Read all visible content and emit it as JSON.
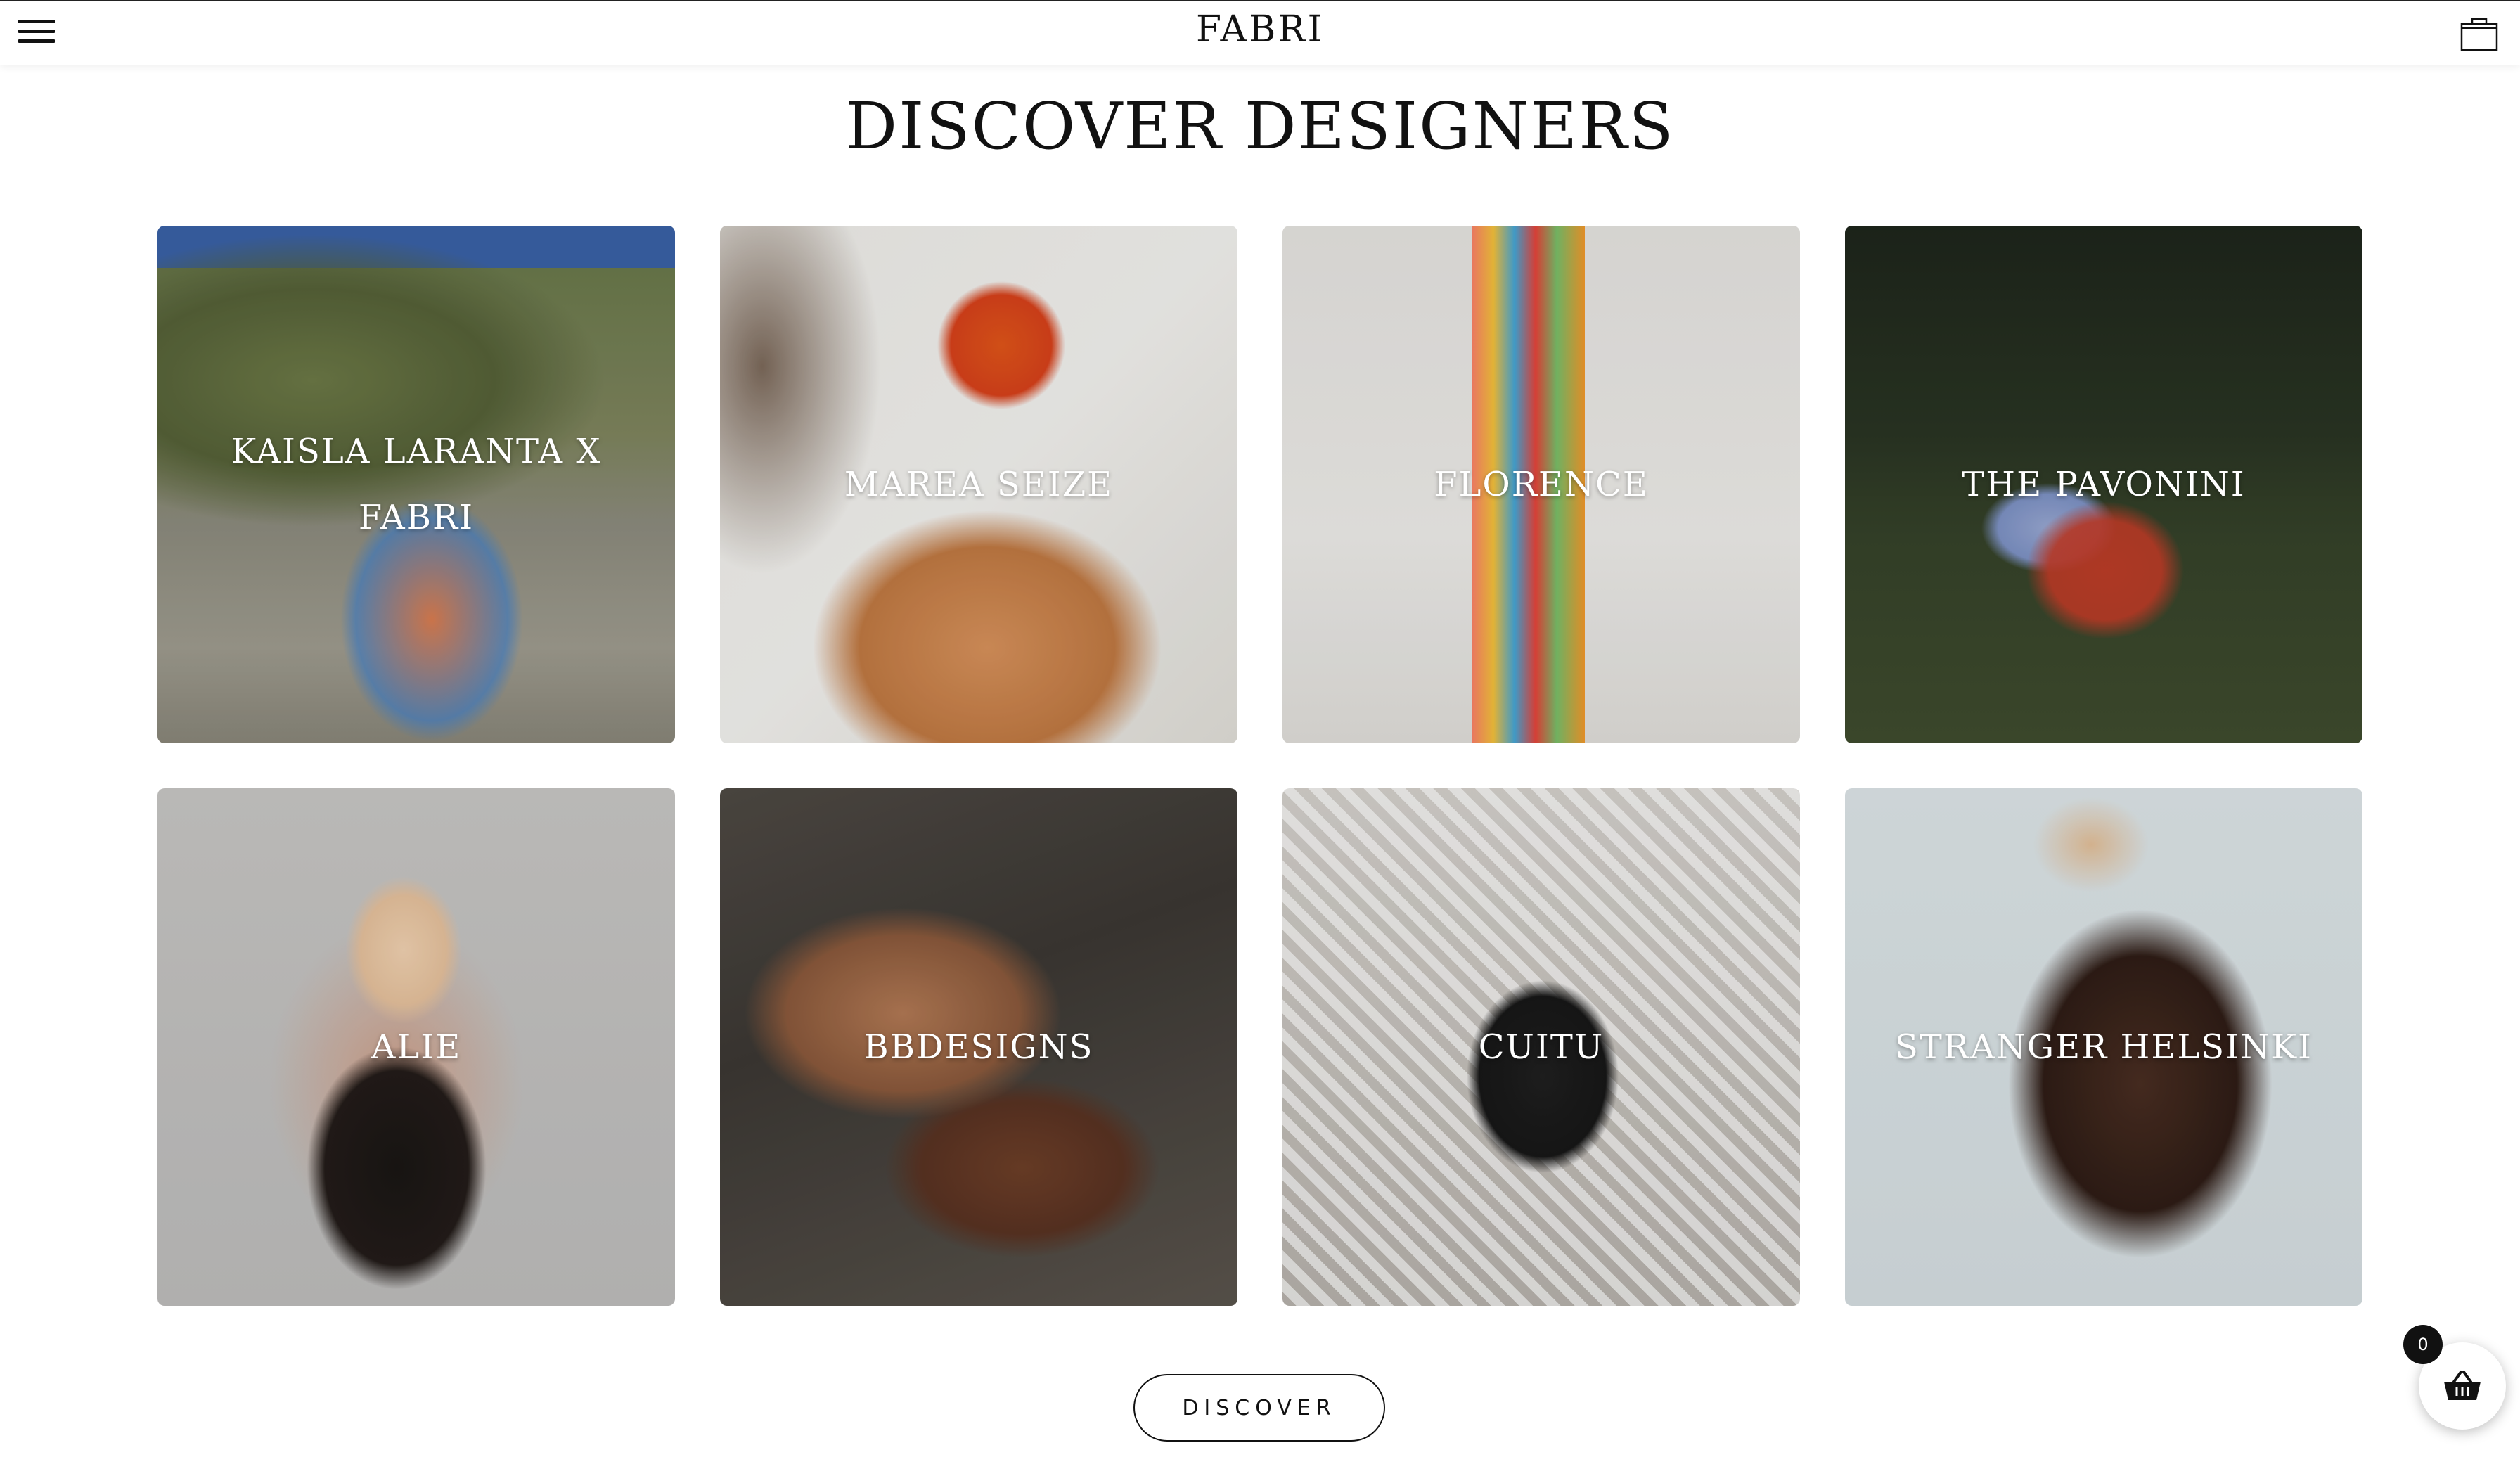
{
  "header": {
    "logo": "FABRI",
    "menu_icon": "hamburger-menu-icon",
    "cart_icon": "shopping-bag-icon"
  },
  "main": {
    "title": "DISCOVER DESIGNERS",
    "designers": [
      {
        "name": "KAISLA LARANTA X FABRI"
      },
      {
        "name": "MAREA SEIZE"
      },
      {
        "name": "FLORENCE"
      },
      {
        "name": "THE PAVONINI"
      },
      {
        "name": "ALIE"
      },
      {
        "name": "BBDESIGNS"
      },
      {
        "name": "CUITU"
      },
      {
        "name": "STRANGER HELSINKI"
      }
    ],
    "discover_label": "DISCOVER"
  },
  "floating_cart": {
    "count": "0",
    "icon": "basket-icon"
  }
}
